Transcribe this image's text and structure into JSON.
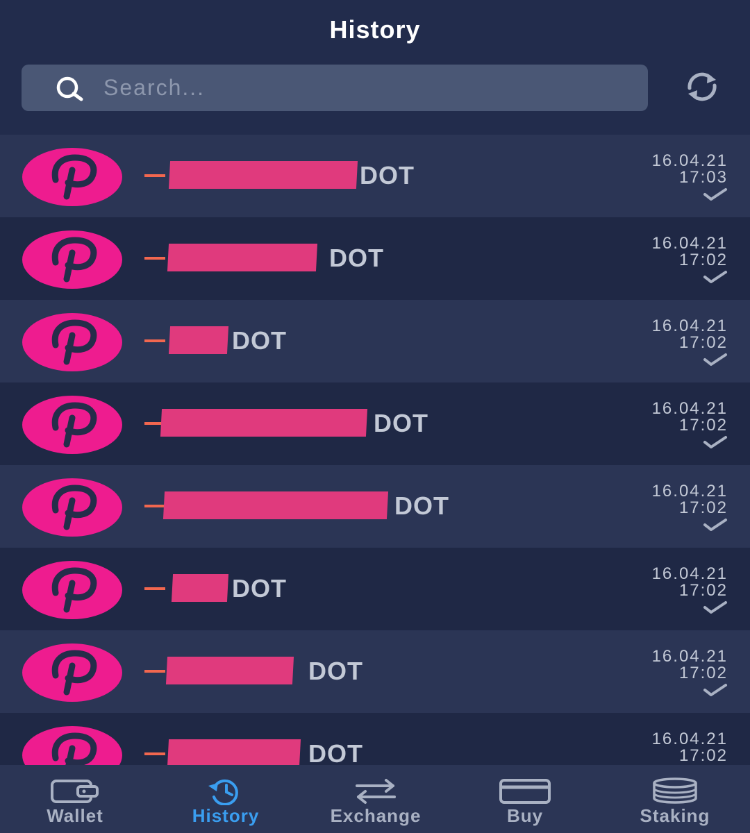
{
  "header": {
    "title": "History",
    "search_placeholder": "Search...",
    "search_icon": "search-icon",
    "refresh_icon": "refresh-icon"
  },
  "colors": {
    "background": "#1e2745",
    "accent_pink": "#ee1c8f",
    "active_tab": "#3a9ef0",
    "minus": "#f2674f"
  },
  "transactions": [
    {
      "sign": "−",
      "amount": "[redacted]",
      "ticker": "DOT",
      "date": "16.04.21",
      "time": "17:03",
      "status_icon": "check-icon",
      "coin_icon": "polkadot-icon"
    },
    {
      "sign": "−",
      "amount": "[redacted]",
      "ticker": "DOT",
      "date": "16.04.21",
      "time": "17:02",
      "status_icon": "check-icon",
      "coin_icon": "polkadot-icon"
    },
    {
      "sign": "−",
      "amount": "[redacted]",
      "ticker": "DOT",
      "date": "16.04.21",
      "time": "17:02",
      "status_icon": "check-icon",
      "coin_icon": "polkadot-icon"
    },
    {
      "sign": "−",
      "amount": "[redacted]",
      "ticker": "DOT",
      "date": "16.04.21",
      "time": "17:02",
      "status_icon": "check-icon",
      "coin_icon": "polkadot-icon"
    },
    {
      "sign": "−",
      "amount": "[redacted]",
      "ticker": "DOT",
      "date": "16.04.21",
      "time": "17:02",
      "status_icon": "check-icon",
      "coin_icon": "polkadot-icon"
    },
    {
      "sign": "−",
      "amount": "[redacted]",
      "ticker": "DOT",
      "date": "16.04.21",
      "time": "17:02",
      "status_icon": "check-icon",
      "coin_icon": "polkadot-icon"
    },
    {
      "sign": "−",
      "amount": "[redacted]",
      "ticker": "DOT",
      "date": "16.04.21",
      "time": "17:02",
      "status_icon": "check-icon",
      "coin_icon": "polkadot-icon"
    },
    {
      "sign": "−",
      "amount": "[redacted]",
      "ticker": "DOT",
      "date": "16.04.21",
      "time": "17:02",
      "status_icon": "check-icon",
      "coin_icon": "polkadot-icon"
    }
  ],
  "nav": {
    "items": [
      {
        "label": "Wallet",
        "icon": "wallet-icon",
        "active": false
      },
      {
        "label": "History",
        "icon": "history-icon",
        "active": true
      },
      {
        "label": "Exchange",
        "icon": "exchange-icon",
        "active": false
      },
      {
        "label": "Buy",
        "icon": "card-icon",
        "active": false
      },
      {
        "label": "Staking",
        "icon": "coins-stack-icon",
        "active": false
      }
    ]
  }
}
